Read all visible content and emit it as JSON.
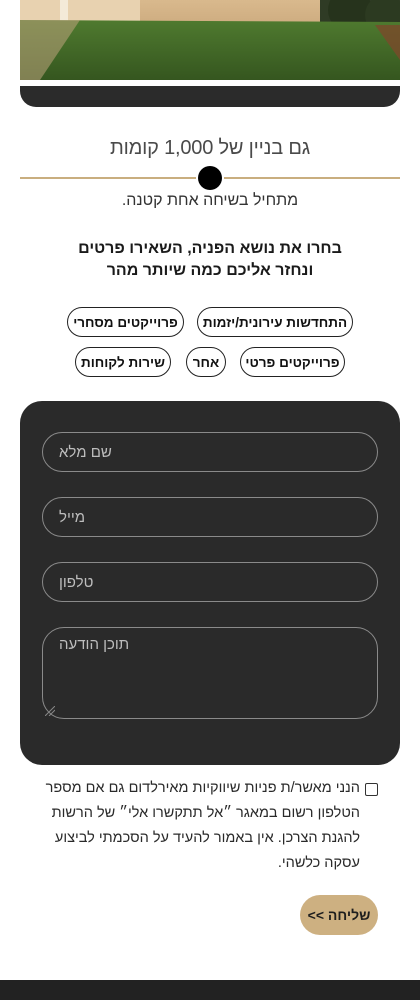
{
  "hero": {
    "image": "garden-lawn-photo"
  },
  "heading": {
    "subtitle": "גם בניין של 1,000 קומות",
    "tagline": "מתחיל בשיחה אחת קטנה.",
    "prompt_line1": "בחרו את נושא הפניה, השאירו פרטים",
    "prompt_line2": "ונחזר אליכם כמה שיותר מהר"
  },
  "topics": [
    {
      "label": "התחדשות עירונית/יזמות"
    },
    {
      "label": "פרוייקטים מסחרי"
    },
    {
      "label": "פרוייקטים פרטי"
    },
    {
      "label": "אחר"
    },
    {
      "label": "שירות לקוחות"
    }
  ],
  "form": {
    "full_name_placeholder": "שם מלא",
    "email_placeholder": "מייל",
    "phone_placeholder": "טלפון",
    "message_placeholder": "תוכן הודעה"
  },
  "consent": {
    "checked": false,
    "text": "הנני מאשר/ת פניות שיווקיות מאירלדום גם אם מספר הטלפון רשום במאגר ״אל תתקשרו אלי״ של הרשות להגנת הצרכן. אין באמור להעיד על הסכמתי לביצוע עסקה כלשהי."
  },
  "submit_label": "שליחה >>",
  "colors": {
    "accent": "#c9ae7f",
    "button": "#cdb081",
    "form_bg": "#2a2a2a"
  }
}
